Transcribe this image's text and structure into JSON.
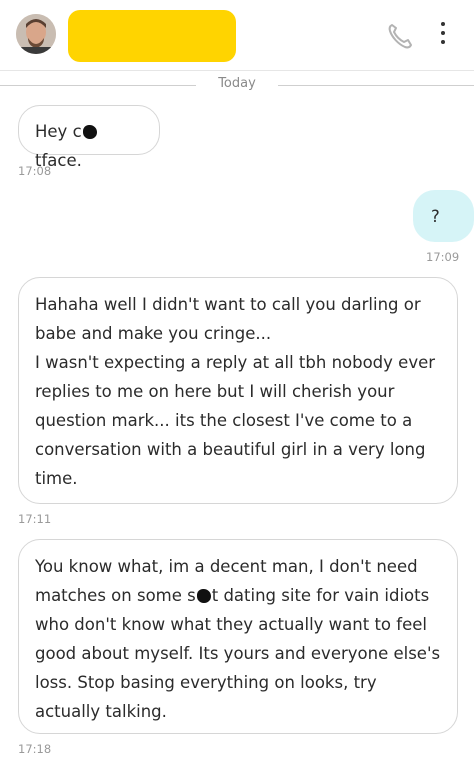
{
  "header": {
    "avatar_icon": "profile-photo",
    "call_icon": "phone-icon",
    "menu_icon": "more-vertical-icon",
    "redaction_color": "#ffd400"
  },
  "chat": {
    "day_label": "Today",
    "messages": [
      {
        "direction": "incoming",
        "text_before": "Hey c",
        "text_after": "tface.",
        "time": "17:08"
      },
      {
        "direction": "outgoing",
        "text": "?",
        "time": "17:09"
      },
      {
        "direction": "incoming",
        "text": "Hahaha well I didn't want to call you darling or babe and make you cringe...\nI wasn't expecting a reply at all tbh nobody ever replies to me on here but I will cherish your question mark... its the closest I've come to a conversation with a beautiful girl in a very long time.",
        "time": "17:11"
      },
      {
        "direction": "incoming",
        "text_before": "You know what, im a decent man, I don't need matches on some s",
        "text_after": "t dating site for vain idiots who don't know what they actually want to feel good about myself. Its yours and everyone else's loss. Stop basing everything on looks, try actually talking.",
        "time": "17:18"
      }
    ]
  },
  "colors": {
    "outgoing_bubble": "#d6f4f7",
    "incoming_border": "#d6d6d6"
  }
}
